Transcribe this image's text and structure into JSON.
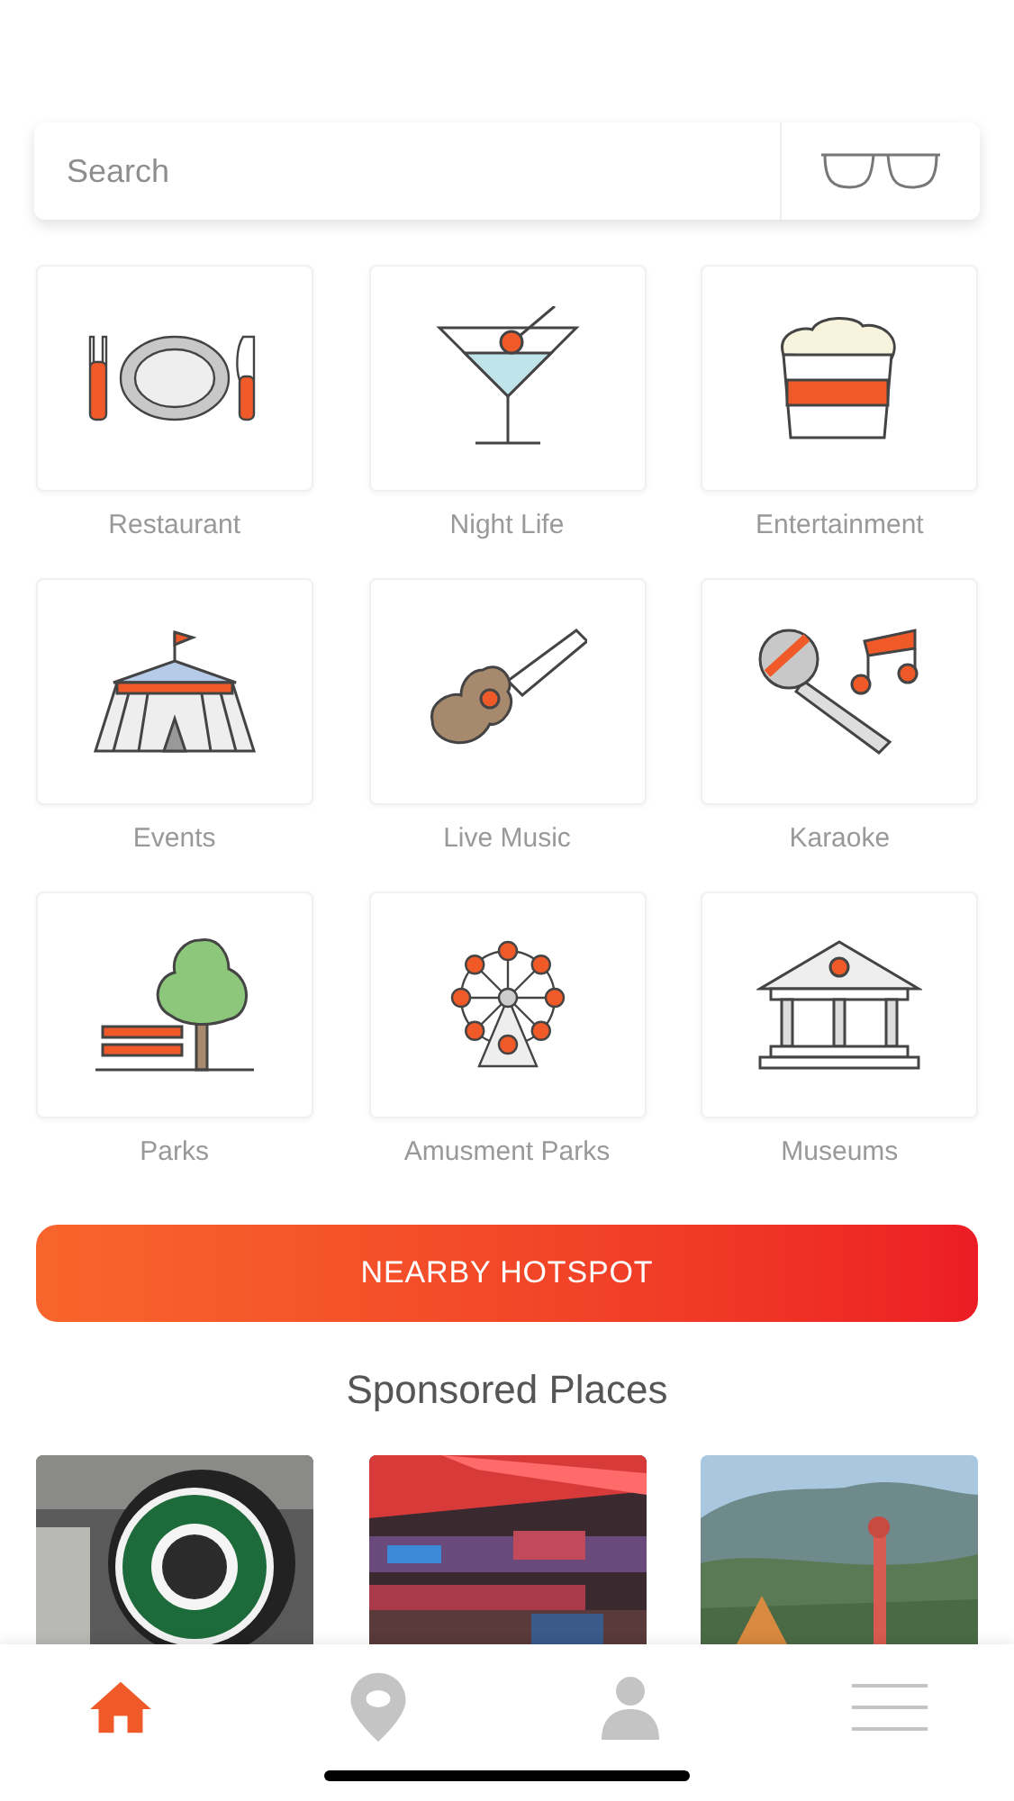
{
  "search": {
    "placeholder": "Search"
  },
  "categories": [
    {
      "label": "Restaurant"
    },
    {
      "label": "Night Life"
    },
    {
      "label": "Entertainment"
    },
    {
      "label": "Events"
    },
    {
      "label": "Live Music"
    },
    {
      "label": "Karaoke"
    },
    {
      "label": "Parks"
    },
    {
      "label": "Amusment Parks"
    },
    {
      "label": "Museums"
    }
  ],
  "nearby_button": {
    "label": "NEARBY HOTSPOT"
  },
  "sponsored": {
    "title": "Sponsored Places"
  },
  "tab_bar": [
    {
      "selected": true
    },
    {
      "selected": false
    },
    {
      "selected": false
    },
    {
      "selected": false
    }
  ]
}
